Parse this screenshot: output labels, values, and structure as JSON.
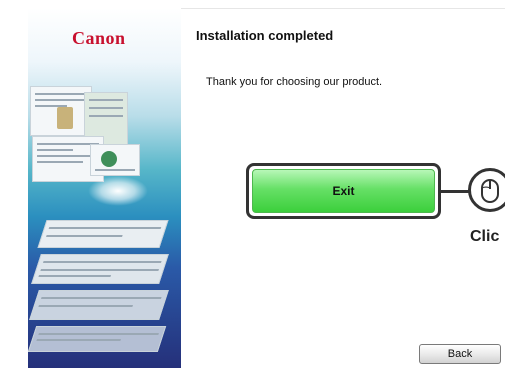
{
  "brand": {
    "logo_text": "Canon",
    "logo_color": "#c8102e"
  },
  "header": {
    "title": "Installation completed"
  },
  "main": {
    "message": "Thank you for choosing our product.",
    "exit_label": "Exit",
    "click_hint": "Clic",
    "click_icon": "mouse-icon"
  },
  "footer": {
    "back_label": "Back"
  },
  "colors": {
    "exit_green": "#3ccf3c",
    "sidebar_blue": "#2a5aa8"
  }
}
